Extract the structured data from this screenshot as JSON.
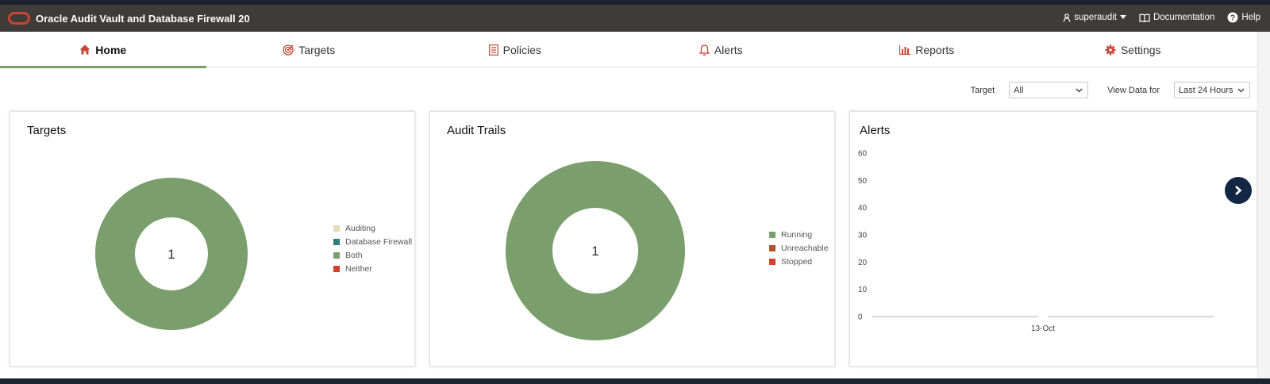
{
  "header": {
    "app_title": "Oracle Audit Vault and Database Firewall 20",
    "user": "superaudit",
    "documentation": "Documentation",
    "help": "Help"
  },
  "nav": {
    "tabs": [
      {
        "label": "Home",
        "icon": "home-icon",
        "active": true
      },
      {
        "label": "Targets",
        "icon": "target-icon",
        "active": false
      },
      {
        "label": "Policies",
        "icon": "policy-list-icon",
        "active": false
      },
      {
        "label": "Alerts",
        "icon": "bell-icon",
        "active": false
      },
      {
        "label": "Reports",
        "icon": "bar-chart-icon",
        "active": false
      },
      {
        "label": "Settings",
        "icon": "gear-icon",
        "active": false
      }
    ]
  },
  "filters": {
    "target_label": "Target",
    "target_value": "All",
    "view_label": "View Data for",
    "view_value": "Last 24 Hours"
  },
  "colors": {
    "accent": "#c74634",
    "header_bg": "#3e3b38",
    "donut_green": "#7a9e6c",
    "nav_dark": "#132744"
  },
  "cards": {
    "targets": {
      "title": "Targets"
    },
    "audit_trails": {
      "title": "Audit Trails"
    },
    "alerts": {
      "title": "Alerts"
    }
  },
  "chart_data": [
    {
      "type": "pie",
      "title": "Targets",
      "categories": [
        "Auditing",
        "Database Firewall",
        "Both",
        "Neither"
      ],
      "values": [
        0,
        0,
        1,
        0
      ],
      "colors": [
        "#e3dcb8",
        "#2f7c7d",
        "#7a9e6c",
        "#d1412b"
      ],
      "center_label": "1",
      "legend_position": "right"
    },
    {
      "type": "pie",
      "title": "Audit Trails",
      "categories": [
        "Running",
        "Unreachable",
        "Stopped"
      ],
      "values": [
        1,
        0,
        0
      ],
      "colors": [
        "#7a9e6c",
        "#b5522e",
        "#d1412b"
      ],
      "center_label": "1",
      "legend_position": "right"
    },
    {
      "type": "bar",
      "title": "Alerts",
      "categories": [
        "13-Oct"
      ],
      "values": [
        0
      ],
      "ylim": [
        0,
        60
      ],
      "yticks": [
        "0",
        "10",
        "20",
        "30",
        "40",
        "50",
        "60"
      ],
      "grid": false
    }
  ]
}
